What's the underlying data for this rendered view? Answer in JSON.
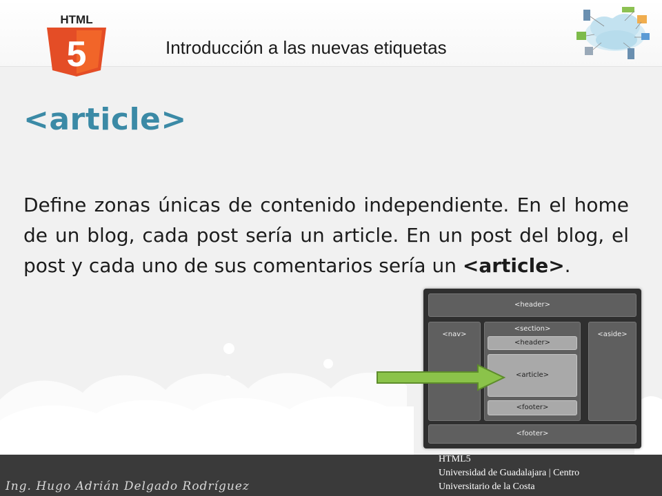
{
  "header": {
    "logo_text": "HTML",
    "logo_digit": "5",
    "title": "Introducción a las nuevas etiquetas",
    "cloud_graphic_icon": "cloud-computing-icon"
  },
  "content": {
    "heading": "<article>",
    "paragraph_text": "Define zonas únicas de contenido independiente. En el home de un blog, cada post sería un article. En un post del blog, el post y cada uno de sus comentarios sería un ",
    "paragraph_tag": "<article>",
    "paragraph_end": "."
  },
  "diagram": {
    "header": "<header>",
    "nav": "<nav>",
    "section": "<section>",
    "section_header": "<header>",
    "article": "<article>",
    "section_footer": "<footer>",
    "aside": "<aside>",
    "footer": "<footer>"
  },
  "footer": {
    "author": "Ing. Hugo Adrián Delgado Rodríguez",
    "line1": "HTML5",
    "line2": "Universidad de Guadalajara | Centro",
    "line3": "Universitario de la Costa"
  },
  "colors": {
    "heading": "#3b8aa6",
    "html5_orange": "#e44d26",
    "arrow_green": "#8bc34a",
    "footer_bg": "#3a3a3a"
  }
}
